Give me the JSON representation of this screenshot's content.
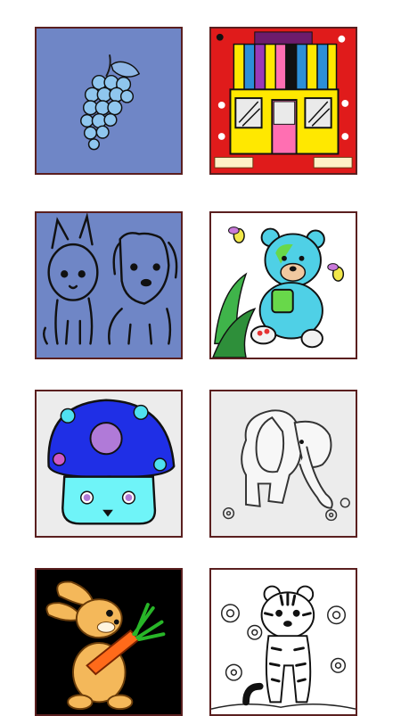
{
  "grid": {
    "items": [
      {
        "subject": "grapes",
        "icon": "grapes-icon",
        "background": "#6f86c6"
      },
      {
        "subject": "shop",
        "icon": "shop-icon",
        "background": "#e01b1b"
      },
      {
        "subject": "kitten-and-puppy",
        "icon": "kitten-puppy-icon",
        "background": "#6f86c6"
      },
      {
        "subject": "bear-and-bees",
        "icon": "bear-icon",
        "background": "#ffffff"
      },
      {
        "subject": "mushroom-house",
        "icon": "mushroom-icon",
        "background": "#ececec"
      },
      {
        "subject": "elephant",
        "icon": "elephant-icon",
        "background": "#ececec"
      },
      {
        "subject": "rabbit-with-carrot",
        "icon": "rabbit-icon",
        "background": "#000000"
      },
      {
        "subject": "tiger-cub",
        "icon": "tiger-icon",
        "background": "#ffffff"
      }
    ]
  }
}
